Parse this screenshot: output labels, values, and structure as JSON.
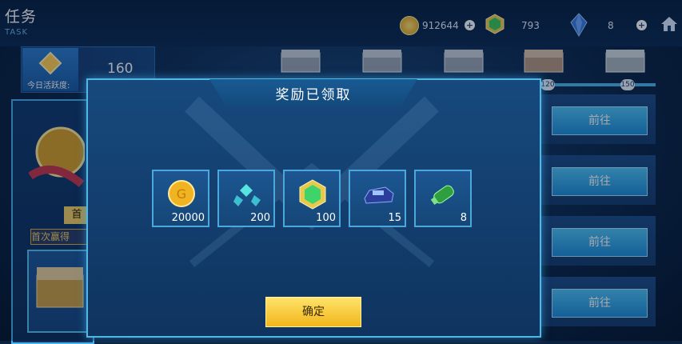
{
  "header": {
    "title": "任务",
    "subtitle": "TASK"
  },
  "currencies": {
    "gold": "912644",
    "gems": "793",
    "crystals": "8"
  },
  "activity": {
    "label": "今日活跃度:",
    "value": "160"
  },
  "milestones": [
    "120",
    "150"
  ],
  "left_panel": {
    "badge": "首",
    "first_win_label": "首次赢得"
  },
  "task_rows": [
    {
      "button": "前往"
    },
    {
      "button": "前往"
    },
    {
      "button": "前往"
    },
    {
      "button": "前往"
    }
  ],
  "modal": {
    "title": "奖励已领取",
    "rewards": [
      {
        "icon": "gold-coin-icon",
        "amount": "20000"
      },
      {
        "icon": "energy-shard-icon",
        "amount": "200"
      },
      {
        "icon": "green-gem-icon",
        "amount": "100"
      },
      {
        "icon": "race-car-icon",
        "amount": "15"
      },
      {
        "icon": "nitro-canister-icon",
        "amount": "8"
      }
    ],
    "confirm": "确定"
  },
  "colors": {
    "accent": "#4fc4f8",
    "confirm": "#f1b51b",
    "panel": "#17497d"
  }
}
